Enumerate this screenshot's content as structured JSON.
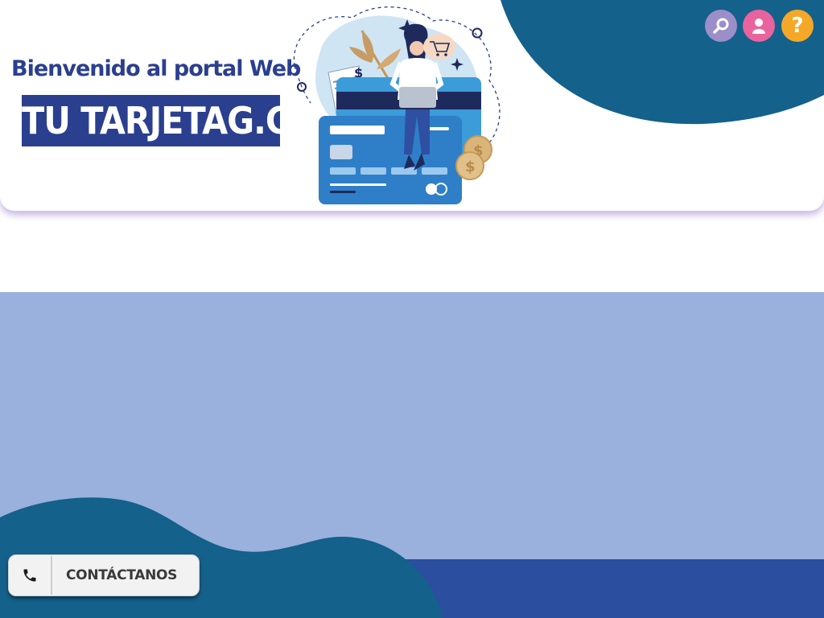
{
  "header": {
    "welcome": "Bienvenido al portal Web",
    "brand": "TU TARJETAG.COM",
    "help_glyph": "?"
  },
  "icons": {
    "search": "search-icon",
    "user": "user-icon",
    "help": "help-icon",
    "phone": "phone-icon",
    "illustration": "credit-card-illustration"
  },
  "contact": {
    "label": "CONTÁCTANOS"
  },
  "colors": {
    "brand_blue": "#2b3f8f",
    "teal_blob": "#14618b",
    "hero_bg": "#9ab1dd",
    "search_btn": "#9b8ec9",
    "user_btn": "#e9639e",
    "help_btn": "#f5a828"
  }
}
